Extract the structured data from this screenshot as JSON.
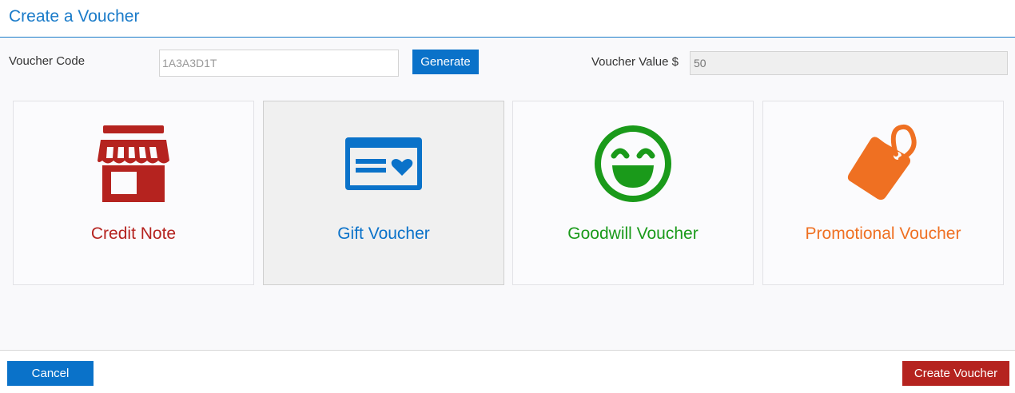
{
  "dialog": {
    "title": "Create a Voucher"
  },
  "form": {
    "code_label": "Voucher Code",
    "code_value": "1A3A3D1T",
    "generate_label": "Generate",
    "value_label": "Voucher Value $",
    "value_value": "50"
  },
  "voucher_types": [
    {
      "label": "Credit Note",
      "icon": "store-icon",
      "color": "#b5231f"
    },
    {
      "label": "Gift Voucher",
      "icon": "gift-card-icon",
      "color": "#0a72c9",
      "selected": true
    },
    {
      "label": "Goodwill Voucher",
      "icon": "smiley-icon",
      "color": "#1a9a1a"
    },
    {
      "label": "Promotional Voucher",
      "icon": "tag-icon",
      "color": "#ef7022"
    }
  ],
  "footer": {
    "cancel_label": "Cancel",
    "create_label": "Create Voucher"
  },
  "colors": {
    "accent": "#1a7bc9",
    "primary_button": "#0a72c9",
    "danger_button": "#b5231f"
  }
}
